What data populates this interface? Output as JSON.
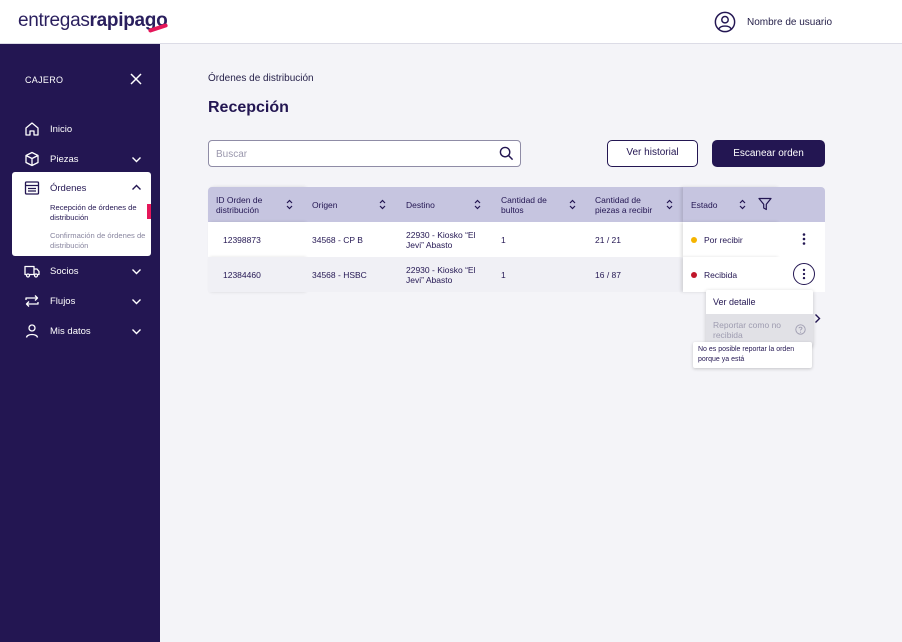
{
  "brand": {
    "logo_part1": "entregas",
    "logo_part2": "rapipago",
    "accent": "#e5175a",
    "primary": "#231652"
  },
  "user": {
    "name": "Nombre de usuario",
    "icon": "user-circle-icon"
  },
  "sidebar": {
    "title": "CAJERO",
    "items": [
      {
        "label": "Inicio",
        "icon": "home-icon"
      },
      {
        "label": "Piezas",
        "icon": "box-icon"
      },
      {
        "label": "Órdenes",
        "icon": "list-icon",
        "expanded": true,
        "subitems": [
          {
            "label": "Recepción de órdenes de distribución",
            "active": true
          },
          {
            "label": "Confirmación de órdenes de distribución",
            "active": false
          }
        ]
      },
      {
        "label": "Socios",
        "icon": "truck-icon"
      },
      {
        "label": "Flujos",
        "icon": "repeat-icon"
      },
      {
        "label": "Mis datos",
        "icon": "user-icon"
      }
    ]
  },
  "main": {
    "breadcrumb": "Órdenes de distribución",
    "title": "Recepción",
    "search_placeholder": "Buscar",
    "btn_history": "Ver historial",
    "btn_scan": "Escanear orden"
  },
  "table": {
    "headers": [
      "ID Orden de distribución",
      "Origen",
      "Destino",
      "Cantidad de bultos",
      "Cantidad de piezas a recibir",
      "Estado"
    ],
    "rows": [
      {
        "id": "12398873",
        "origen": "34568 - CP B",
        "destino": "22930 - Kiosko “El Jevi” Abasto",
        "bultos": "1",
        "piezas": "21 / 21",
        "estado": "Por recibir",
        "estado_color": "#f5b400"
      },
      {
        "id": "12384460",
        "origen": "34568 - HSBC",
        "destino": "22930 - Kiosko “El Jevi” Abasto",
        "bultos": "1",
        "piezas": "16 / 87",
        "estado": "Recibida",
        "estado_color": "#c0162a"
      }
    ]
  },
  "context_menu": {
    "item1": "Ver detalle",
    "item2": "Reportar como no recibida"
  },
  "tooltip": "No es posible reportar la orden porque ya está"
}
